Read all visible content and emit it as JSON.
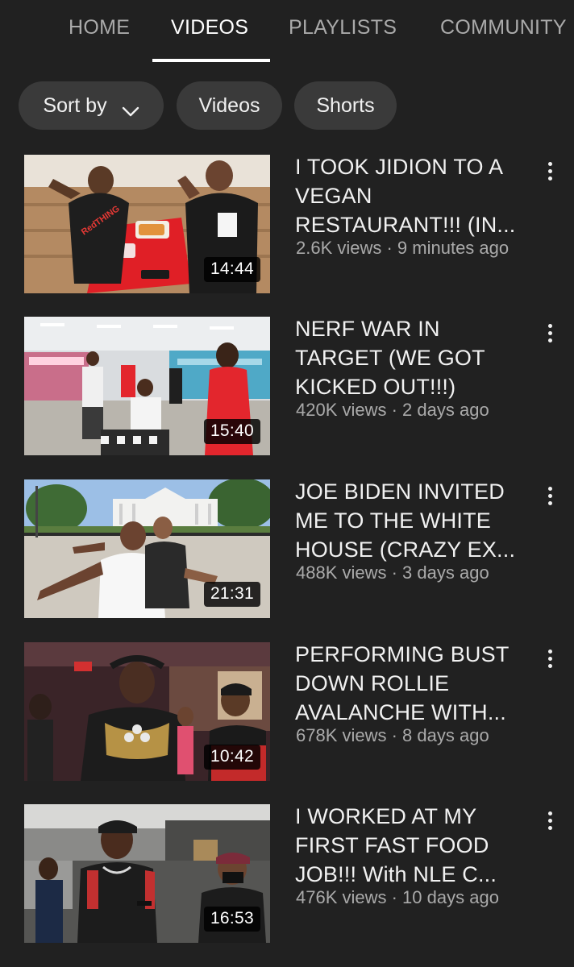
{
  "tabs": [
    {
      "label": "HOME",
      "active": false
    },
    {
      "label": "VIDEOS",
      "active": true
    },
    {
      "label": "PLAYLISTS",
      "active": false
    },
    {
      "label": "COMMUNITY",
      "active": false
    }
  ],
  "chips": {
    "sort_by": "Sort by",
    "videos": "Videos",
    "shorts": "Shorts"
  },
  "videos": [
    {
      "title": "I TOOK JIDION TO A VEGAN RESTAURANT!!! (IN...",
      "views": "2.6K views",
      "age": "9 minutes ago",
      "meta": "2.6K views · 9 minutes ago",
      "duration": "14:44",
      "shirt_text": "RedTHING"
    },
    {
      "title": "NERF WAR IN TARGET (WE GOT KICKED OUT!!!)",
      "views": "420K views",
      "age": "2 days ago",
      "meta": "420K views · 2 days ago",
      "duration": "15:40"
    },
    {
      "title": "JOE BIDEN INVITED ME TO THE WHITE HOUSE (CRAZY EX...",
      "views": "488K views",
      "age": "3 days ago",
      "meta": "488K views · 3 days ago",
      "duration": "21:31"
    },
    {
      "title": "PERFORMING BUST DOWN ROLLIE AVALANCHE WITH...",
      "views": "678K views",
      "age": "8 days ago",
      "meta": "678K views · 8 days ago",
      "duration": "10:42"
    },
    {
      "title": "I WORKED AT MY FIRST FAST FOOD JOB!!! With NLE C...",
      "views": "476K views",
      "age": "10 days ago",
      "meta": "476K views · 10 days ago",
      "duration": "16:53"
    }
  ],
  "icons": {
    "sort": "chevron-down-icon",
    "menu": "more-vertical-icon"
  },
  "colors": {
    "background": "#212121",
    "chip": "#3a3a3a",
    "text_primary": "#f1f1f1",
    "text_secondary": "#aaaaaa"
  }
}
